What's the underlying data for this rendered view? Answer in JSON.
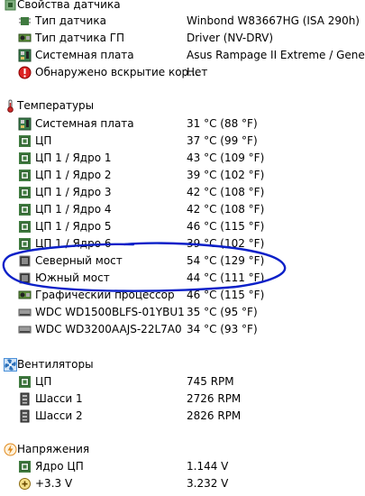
{
  "sensor_props": {
    "header": "Свойства датчика",
    "rows": [
      {
        "icon": "sensor-chip-icon",
        "label": "Тип датчика",
        "value": "Winbond W83667HG  (ISA 290h)"
      },
      {
        "icon": "gpu-icon",
        "label": "Тип датчика ГП",
        "value": "Driver  (NV-DRV)"
      },
      {
        "icon": "motherboard-icon",
        "label": "Системная плата",
        "value": "Asus Rampage II Extreme / Gene"
      },
      {
        "icon": "chassis-open-icon",
        "label": "Обнаружено вскрытие кор...",
        "value": "Нет"
      }
    ]
  },
  "temperatures": {
    "header": "Температуры",
    "rows": [
      {
        "icon": "motherboard-icon",
        "label": "Системная плата",
        "value": "31 °C  (88 °F)"
      },
      {
        "icon": "cpu-icon",
        "label": "ЦП",
        "value": "37 °C  (99 °F)"
      },
      {
        "icon": "cpu-icon",
        "label": "ЦП 1 / Ядро 1",
        "value": "43 °C  (109 °F)"
      },
      {
        "icon": "cpu-icon",
        "label": "ЦП 1 / Ядро 2",
        "value": "39 °C  (102 °F)"
      },
      {
        "icon": "cpu-icon",
        "label": "ЦП 1 / Ядро 3",
        "value": "42 °C  (108 °F)"
      },
      {
        "icon": "cpu-icon",
        "label": "ЦП 1 / Ядро 4",
        "value": "42 °C  (108 °F)"
      },
      {
        "icon": "cpu-icon",
        "label": "ЦП 1 / Ядро 5",
        "value": "46 °C  (115 °F)"
      },
      {
        "icon": "cpu-icon",
        "label": "ЦП 1 / Ядро 6",
        "value": "39 °C  (102 °F)"
      },
      {
        "icon": "chipset-icon",
        "label": "Северный мост",
        "value": "54 °C  (129 °F)"
      },
      {
        "icon": "chipset-icon",
        "label": "Южный мост",
        "value": "44 °C  (111 °F)"
      },
      {
        "icon": "gpu-icon",
        "label": "Графический процессор",
        "value": "46 °C  (115 °F)"
      },
      {
        "icon": "hdd-icon",
        "label": "WDC WD1500BLFS-01YBU1",
        "value": "35 °C  (95 °F)"
      },
      {
        "icon": "hdd-icon",
        "label": "WDC WD3200AAJS-22L7A0",
        "value": "34 °C  (93 °F)"
      }
    ]
  },
  "fans": {
    "header": "Вентиляторы",
    "rows": [
      {
        "icon": "cpu-icon",
        "label": "ЦП",
        "value": "745 RPM"
      },
      {
        "icon": "fan-sensor-icon",
        "label": "Шасси 1",
        "value": "2726 RPM"
      },
      {
        "icon": "fan-sensor-icon",
        "label": "Шасси 2",
        "value": "2826 RPM"
      }
    ]
  },
  "voltages": {
    "header": "Напряжения",
    "rows": [
      {
        "icon": "cpu-icon",
        "label": "Ядро ЦП",
        "value": "1.144 V"
      },
      {
        "icon": "voltage-plus-icon",
        "label": "+3.3 V",
        "value": "3.232 V"
      }
    ]
  },
  "colors": {
    "annotation_ellipse": "#0b20c8",
    "chip_green": "#3f7a3f",
    "fan_blue": "#4a90d9",
    "thermo_red": "#d02a2a",
    "voltage_orange": "#e08a1e"
  }
}
